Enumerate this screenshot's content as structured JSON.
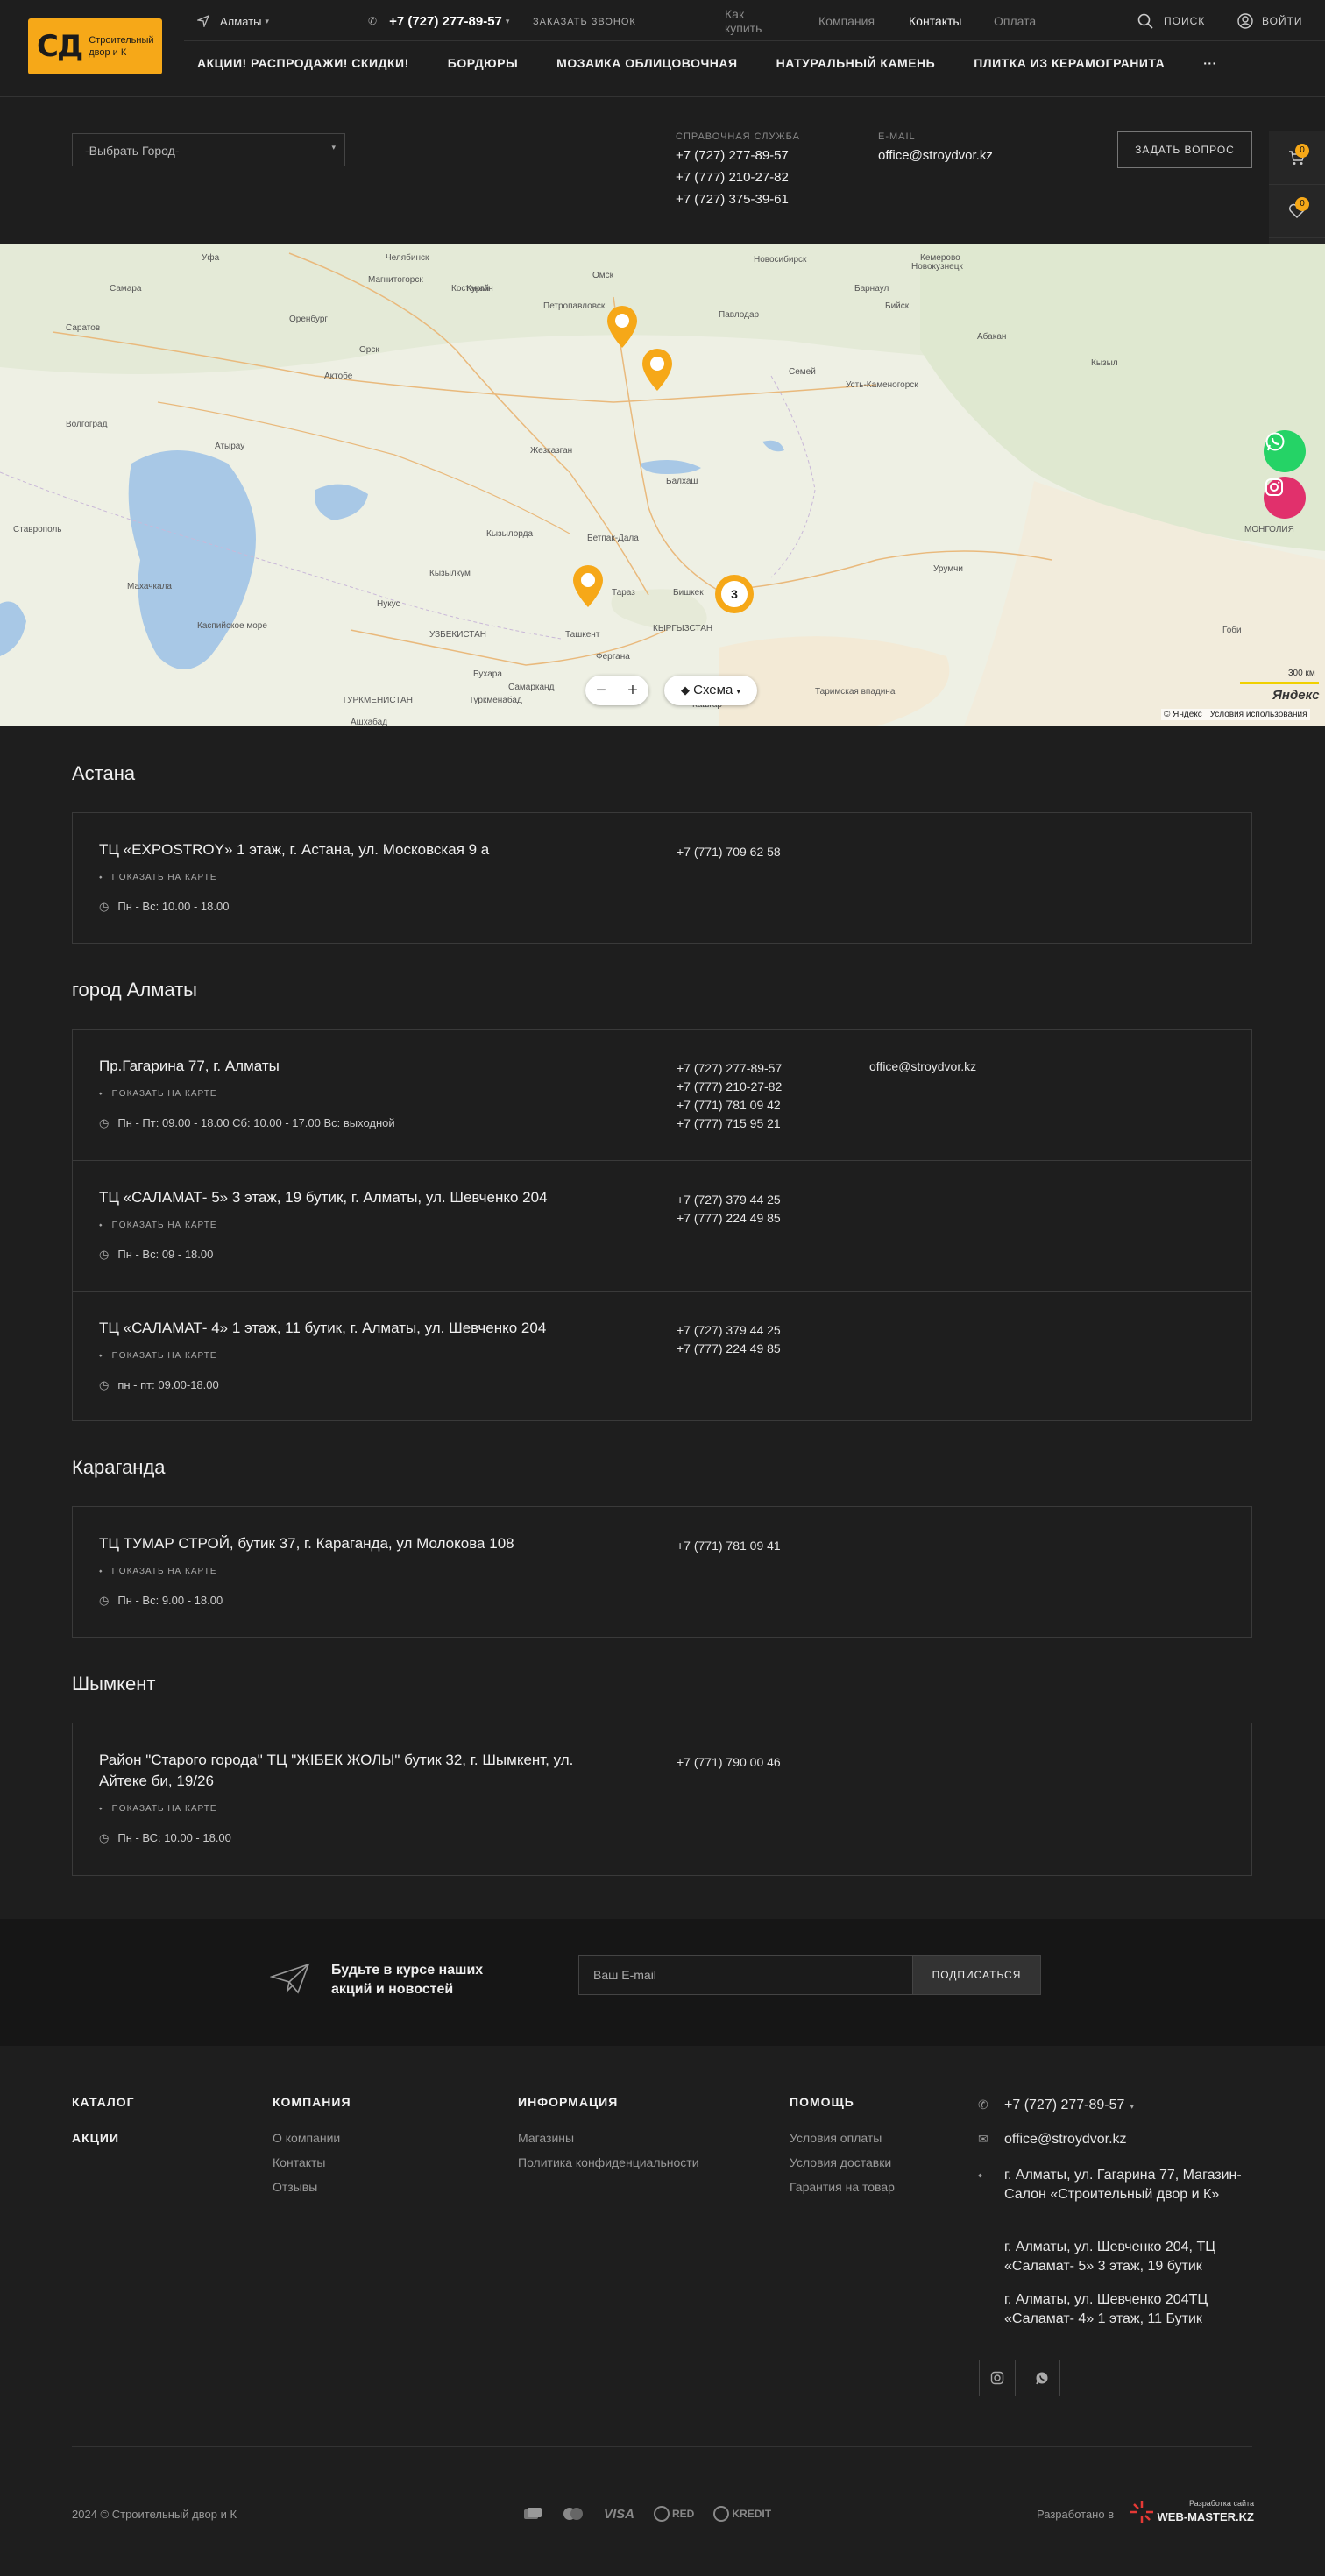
{
  "header": {
    "logo_mark": "СД",
    "logo_text": "Строительный двор и К",
    "city": "Алматы",
    "phone": "+7 (727) 277-89-57",
    "callback": "заказать звонок",
    "top_nav": [
      "Как купить",
      "Компания",
      "Контакты",
      "Оплата"
    ],
    "active_nav": "Контакты",
    "search": "поиск",
    "login": "войти",
    "menu": [
      "АКЦИИ! РАСПРОДАЖИ! СКИДКИ!",
      "БОРДЮРЫ",
      "МОЗАИКА ОБЛИЦОВОЧНАЯ",
      "НАТУРАЛЬНЫЙ КАМЕНЬ",
      "ПЛИТКА ИЗ КЕРАМОГРАНИТА"
    ],
    "more": "···"
  },
  "info": {
    "city_select": "-Выбрать Город-",
    "service_label": "СПРАВОЧНАЯ СЛУЖБА",
    "service_phones": [
      "+7 (727) 277-89-57",
      "+7 (777) 210-27-82",
      "+7 (727) 375-39-61"
    ],
    "email_label": "E-MAIL",
    "email": "office@stroydvor.kz",
    "ask_button": "ЗАДАТЬ ВОПРОС",
    "widgets": [
      {
        "icon": "cart-icon",
        "count": "0"
      },
      {
        "icon": "heart-icon",
        "count": "0"
      },
      {
        "icon": "compare-icon",
        "count": "0"
      }
    ]
  },
  "map": {
    "labels": [
      [
        "Челябинск",
        440,
        10
      ],
      [
        "Курган",
        532,
        45
      ],
      [
        "Омск",
        676,
        30
      ],
      [
        "Новосибирск",
        860,
        12
      ],
      [
        "Уфа",
        230,
        10
      ],
      [
        "Самара",
        125,
        45
      ],
      [
        "Оренбург",
        330,
        80
      ],
      [
        "Орск",
        410,
        115
      ],
      [
        "Магнитогорск",
        420,
        35
      ],
      [
        "Костанай",
        515,
        45
      ],
      [
        "Петропавловск",
        620,
        65
      ],
      [
        "Павлодар",
        820,
        75
      ],
      [
        "Барнаул",
        975,
        45
      ],
      [
        "Бийск",
        1010,
        65
      ],
      [
        "Новокузнецк",
        1040,
        20
      ],
      [
        "Кемерово",
        1050,
        10
      ],
      [
        "Семей",
        900,
        140
      ],
      [
        "Усть-Каменогорск",
        965,
        155
      ],
      [
        "Абакан",
        1115,
        100
      ],
      [
        "Кызыл",
        1245,
        130
      ],
      [
        "Актобе",
        370,
        145
      ],
      [
        "Саратов",
        75,
        90
      ],
      [
        "Волгоград",
        75,
        200
      ],
      [
        "Атырау",
        245,
        225
      ],
      [
        "Жезказган",
        605,
        230
      ],
      [
        "Балхаш",
        760,
        265
      ],
      [
        "Кызылорда",
        555,
        325
      ],
      [
        "Кызылкум",
        490,
        370
      ],
      [
        "Бетпак-Дала",
        670,
        330
      ],
      [
        "Ставрополь",
        15,
        320
      ],
      [
        "Махачкала",
        145,
        385
      ],
      [
        "Каспийское море",
        225,
        430
      ],
      [
        "Нукус",
        430,
        405
      ],
      [
        "Тараз",
        698,
        392
      ],
      [
        "Бишкек",
        768,
        392
      ],
      [
        "Ташкент",
        645,
        440
      ],
      [
        "Фергана",
        680,
        465
      ],
      [
        "Бухара",
        540,
        485
      ],
      [
        "Самарканд",
        580,
        500
      ],
      [
        "Туркменабад",
        535,
        515
      ],
      [
        "Ашхабад",
        400,
        540
      ],
      [
        "Урумчи",
        1065,
        365
      ],
      [
        "Кашгар",
        790,
        520
      ],
      [
        "Таримская впадина",
        930,
        505
      ],
      [
        "Гоби",
        1395,
        435
      ],
      [
        "МОНГОЛИЯ",
        1420,
        320
      ],
      [
        "УЗБЕКИСТАН",
        490,
        440
      ],
      [
        "ТУРКМЕНИСТАН",
        390,
        515
      ],
      [
        "КЫРГЫЗСТАН",
        745,
        433
      ]
    ],
    "cluster_count": "3",
    "layers_label": "Схема",
    "scale": "300 км",
    "copyright": "© Яндекс",
    "terms": "Условия использования",
    "brand": "Яндекс"
  },
  "sections": [
    {
      "title": "Астана",
      "stores": [
        {
          "address": "ТЦ «EXPOSTROY» 1 этаж, г. Астана, ул. Московская 9 а",
          "show_map": "ПОКАЗАТЬ НА КАРТЕ",
          "hours": "Пн - Вс: 10.00 - 18.00",
          "phones": [
            "+7 (771) 709 62 58"
          ],
          "email": ""
        }
      ]
    },
    {
      "title": "город Алматы",
      "stores": [
        {
          "address": "Пр.Гагарина 77, г. Алматы",
          "show_map": "ПОКАЗАТЬ НА КАРТЕ",
          "hours": "Пн - Пт: 09.00 - 18.00 Сб: 10.00 - 17.00 Вс: выходной",
          "phones": [
            "+7 (727) 277-89-57",
            "+7 (777) 210-27-82",
            "+7 (771) 781 09 42",
            "+7 (777) 715 95 21"
          ],
          "email": "office@stroydvor.kz"
        },
        {
          "address": "ТЦ «САЛАМАТ- 5» 3 этаж, 19 бутик, г. Алматы, ул. Шевченко 204",
          "show_map": "ПОКАЗАТЬ НА КАРТЕ",
          "hours": "Пн - Вс: 09 - 18.00",
          "phones": [
            "+7 (727) 379 44 25",
            "+7 (777) 224 49 85"
          ],
          "email": ""
        },
        {
          "address": "ТЦ «САЛАМАТ- 4» 1 этаж, 11 бутик, г. Алматы, ул. Шевченко 204",
          "show_map": "ПОКАЗАТЬ НА КАРТЕ",
          "hours": "пн - пт: 09.00-18.00",
          "phones": [
            "+7 (727) 379 44 25",
            "+7 (777) 224 49 85"
          ],
          "email": ""
        }
      ]
    },
    {
      "title": "Караганда",
      "stores": [
        {
          "address": "ТЦ ТУМАР СТРОЙ, бутик 37, г. Караганда, ул Молокова 108",
          "show_map": "ПОКАЗАТЬ НА КАРТЕ",
          "hours": "Пн - Вс: 9.00 - 18.00",
          "phones": [
            "+7 (771) 781 09 41"
          ],
          "email": ""
        }
      ]
    },
    {
      "title": "Шымкент",
      "stores": [
        {
          "address": "Район \"Старого города\" ТЦ \"ЖІБЕК ЖОЛЫ\" бутик 32, г. Шымкент, ул. Айтеке би, 19/26",
          "show_map": "ПОКАЗАТЬ НА КАРТЕ",
          "hours": "Пн - ВС: 10.00 - 18.00",
          "phones": [
            "+7 (771) 790 00 46"
          ],
          "email": ""
        }
      ]
    }
  ],
  "subscribe": {
    "text": "Будьте в курсе наших акций и новостей",
    "placeholder": "Ваш E-mail",
    "button": "ПОДПИСАТЬСЯ"
  },
  "footer": {
    "catalog": "КАТАЛОГ",
    "sales": "АКЦИИ",
    "company_title": "КОМПАНИЯ",
    "company_links": [
      "О компании",
      "Контакты",
      "Отзывы"
    ],
    "info_title": "ИНФОРМАЦИЯ",
    "info_links": [
      "Магазины",
      "Политика конфиденциальности"
    ],
    "help_title": "ПОМОЩЬ",
    "help_links": [
      "Условия оплаты",
      "Условия доставки",
      "Гарантия на товар"
    ],
    "phone": "+7 (727) 277-89-57",
    "email": "office@stroydvor.kz",
    "addresses": [
      "г. Алматы, ул. Гагарина 77, Магазин-Салон «Строительный двор и К»",
      "г. Алматы, ул. Шевченко 204, ТЦ «Саламат- 5» 3 этаж, 19 бутик",
      "г. Алматы, ул. Шевченко 204ТЦ «Саламат- 4» 1 этаж, 11 Бутик"
    ],
    "copyright": "2024 © Строительный двор и К",
    "payments": [
      "VISA",
      "RED",
      "KREDIT"
    ],
    "developed_by": "Разработано в",
    "dev_brand": "WEB-MASTER.KZ",
    "dev_tagline": "Разработка сайта"
  },
  "colors": {
    "accent": "#f6a818",
    "bg": "#1e1e1e",
    "whatsapp": "#25d366",
    "instagram": "#e1306c"
  }
}
